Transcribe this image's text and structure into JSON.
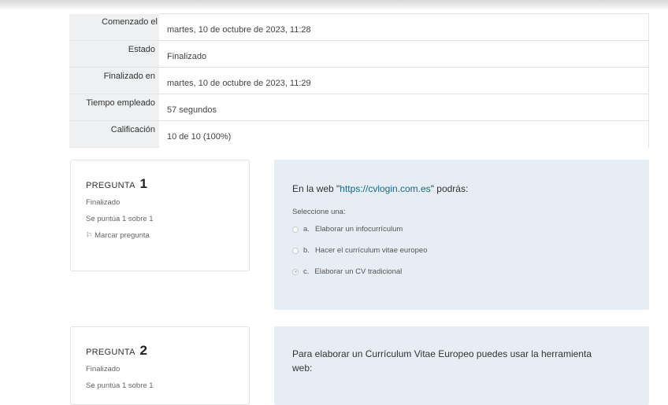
{
  "summary": {
    "rows": [
      {
        "label": "Comenzado el",
        "value": "martes, 10 de octubre de 2023, 11:28"
      },
      {
        "label": "Estado",
        "value": "Finalizado"
      },
      {
        "label": "Finalizado en",
        "value": "martes, 10 de octubre de 2023, 11:29"
      },
      {
        "label": "Tiempo empleado",
        "value": "57 segundos"
      },
      {
        "label": "Calificación",
        "value": "10 de 10 (100%)"
      }
    ]
  },
  "questions": [
    {
      "title_prefix": "PREGUNTA",
      "number": "1",
      "state": "Finalizado",
      "grade": "Se puntúa 1 sobre 1",
      "flag_label": "Marcar pregunta",
      "text_before": "En la web \"",
      "text_link": "https://cvlogin.com.es",
      "text_after": "\" podrás:",
      "prompt": "Seleccione una:",
      "answers": [
        {
          "letter": "a.",
          "text": "Elaborar un infocurrículum",
          "checked": false
        },
        {
          "letter": "b.",
          "text": "Hacer el currículum vitae europeo",
          "checked": false
        },
        {
          "letter": "c.",
          "text": "Elaborar un CV tradicional",
          "checked": true
        }
      ]
    },
    {
      "title_prefix": "PREGUNTA",
      "number": "2",
      "state": "Finalizado",
      "grade": "Se puntúa 1 sobre 1",
      "text": "Para elaborar un Currículum Vitae Europeo puedes usar la herramienta web:"
    }
  ]
}
